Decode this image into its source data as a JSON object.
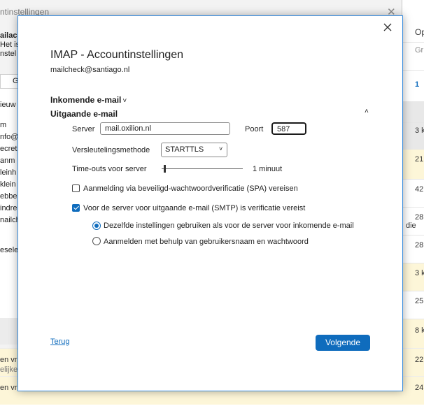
{
  "background": {
    "dialog_title": "ntinstellingen",
    "left_texts": [
      {
        "text": "ailac",
        "bold": true
      },
      {
        "text": "Het is"
      },
      {
        "text": "nstel"
      }
    ],
    "tab_label": "G",
    "list_items": [
      "ieuw",
      "m",
      "nfo@",
      "ecret",
      "anm",
      "leinh",
      "klein",
      "ebbe",
      "indre",
      "nailch",
      "eselec"
    ],
    "right_header_top": "Op",
    "right_header_sub": "Gr",
    "right_cells": [
      {
        "text": "1",
        "style": "white",
        "color": "#0f6cbd"
      },
      {
        "text": "",
        "style": "gray"
      },
      {
        "text": "3 k",
        "style": "gray"
      },
      {
        "text": "21",
        "style": "yellow"
      },
      {
        "text": "42",
        "style": "white"
      },
      {
        "text": "28",
        "style": "white"
      },
      {
        "text": "28",
        "style": "yellow"
      },
      {
        "text": "3 k",
        "style": "yellow"
      },
      {
        "text": "25",
        "style": "white"
      },
      {
        "text": "8 k",
        "style": "yellow"
      }
    ],
    "die_text": "die",
    "mail_rows": [
      {
        "left": "en vra",
        "left2": "elijke",
        "right": "22"
      },
      {
        "left": "en vra",
        "left2": "",
        "right": "24"
      }
    ]
  },
  "dialog": {
    "title": "IMAP - Accountinstellingen",
    "email": "mailcheck@santiago.nl",
    "incoming_section": "Inkomende e-mail",
    "outgoing_section": "Uitgaande e-mail",
    "server_label": "Server",
    "server_value": "mail.oxilion.nl",
    "port_label": "Poort",
    "port_value": "587",
    "encryption_label": "Versleutelingsmethode",
    "encryption_value": "STARTTLS",
    "timeout_label": "Time-outs voor server",
    "timeout_value": "1 minuut",
    "timeout_level_fraction": 0.03,
    "spa_label": "Aanmelding via beveiligd-wachtwoordverificatie (SPA) vereisen",
    "spa_checked": false,
    "smtp_auth_label": "Voor de server voor uitgaande e-mail (SMTP) is verificatie vereist",
    "smtp_auth_checked": true,
    "radio_same_label": "Dezelfde instellingen gebruiken als voor de server voor inkomende e-mail",
    "radio_login_label": "Aanmelden met behulp van gebruikersnaam en wachtwoord",
    "back_label": "Terug",
    "next_label": "Volgende",
    "accent_color": "#0f6cbd"
  }
}
